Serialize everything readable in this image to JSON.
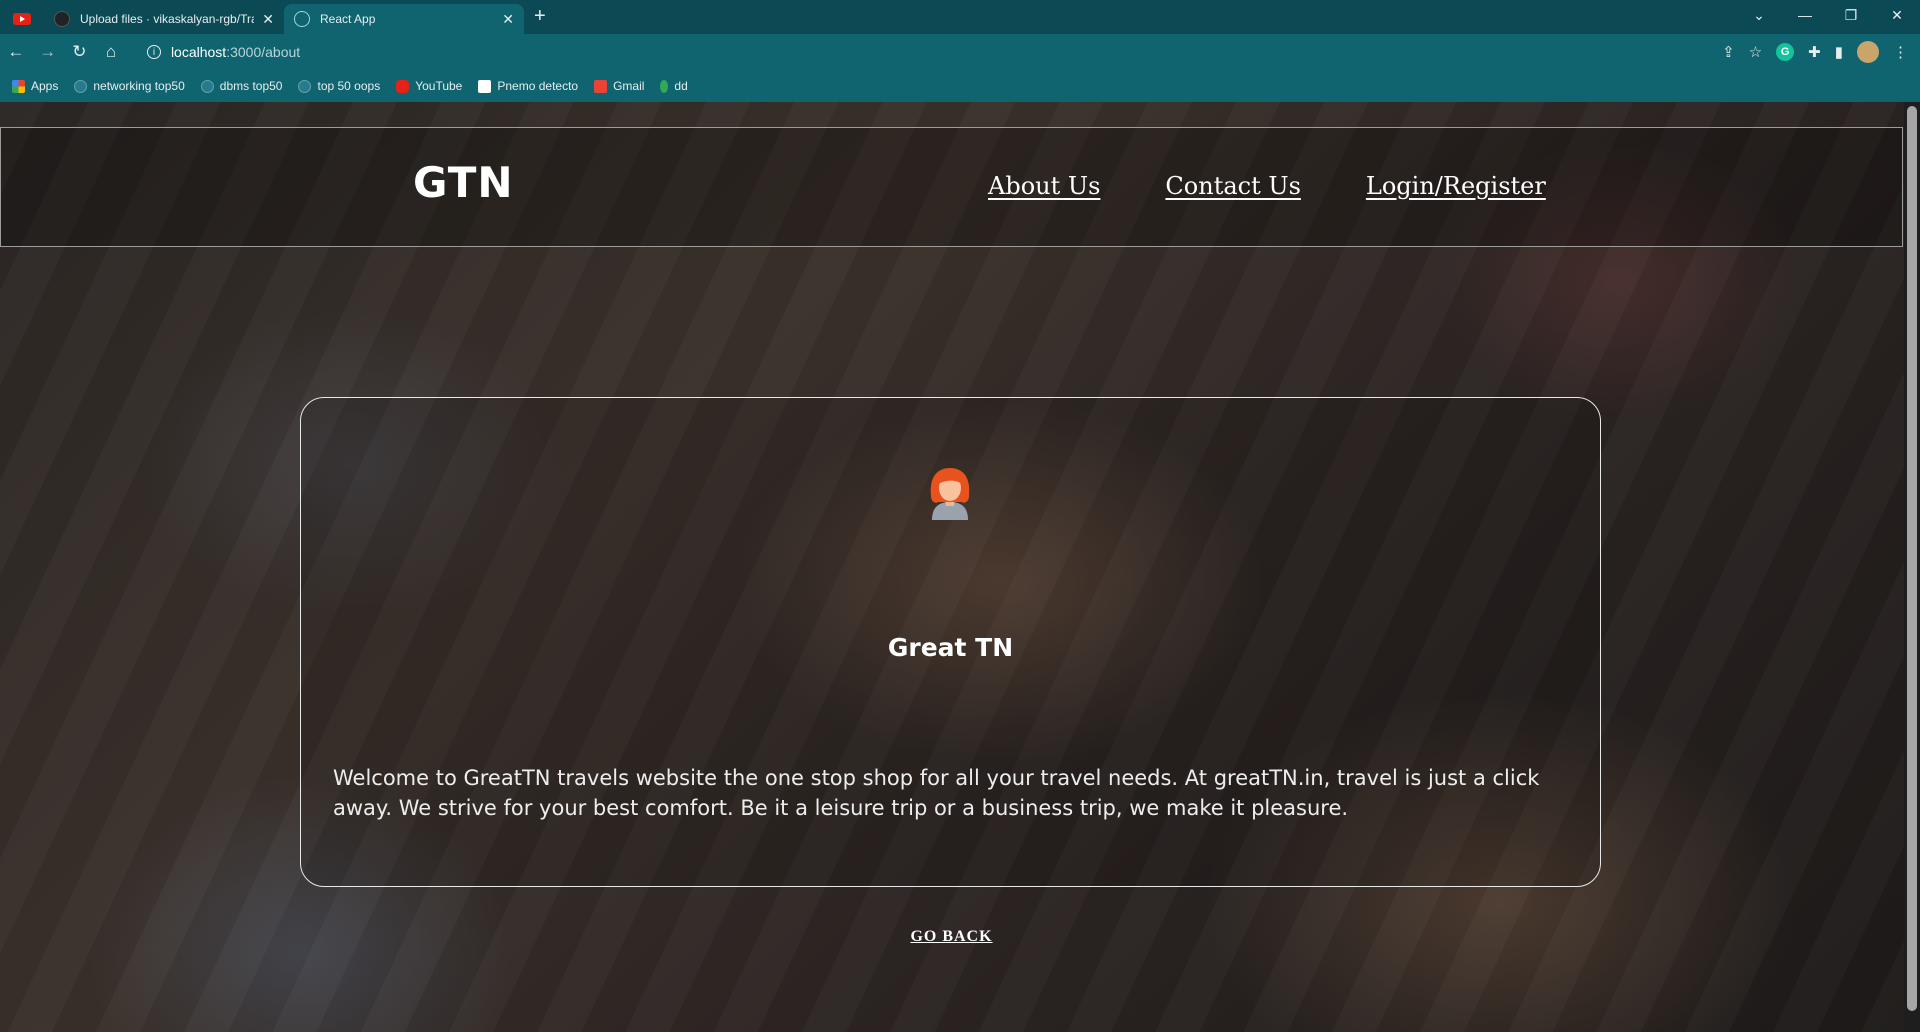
{
  "browser": {
    "tabs": [
      {
        "title": "Upload files · vikaskalyan-rgb/Tra",
        "active": false
      },
      {
        "title": "React App",
        "active": true
      }
    ],
    "address": {
      "host": "localhost",
      "path": ":3000/about"
    },
    "bookmarks": [
      "Apps",
      "networking top50",
      "dbms top50",
      "top 50 oops",
      "YouTube",
      "Pnemo detecto",
      "Gmail",
      "dd"
    ],
    "extension_badge": "G"
  },
  "navbar": {
    "logo": "GTN",
    "links": [
      "About Us",
      "Contact Us",
      "Login/Register"
    ]
  },
  "card": {
    "title": "Great TN",
    "text": "Welcome to GreatTN travels website the one stop shop for all your travel needs. At greatTN.in, travel is just a click away. We strive for your best comfort. Be it a leisure trip or a business trip, we make it pleasure."
  },
  "goback_label": "GO BACK",
  "colors": {
    "tab_bar": "#0b4a55",
    "toolbar": "#0f6470"
  }
}
